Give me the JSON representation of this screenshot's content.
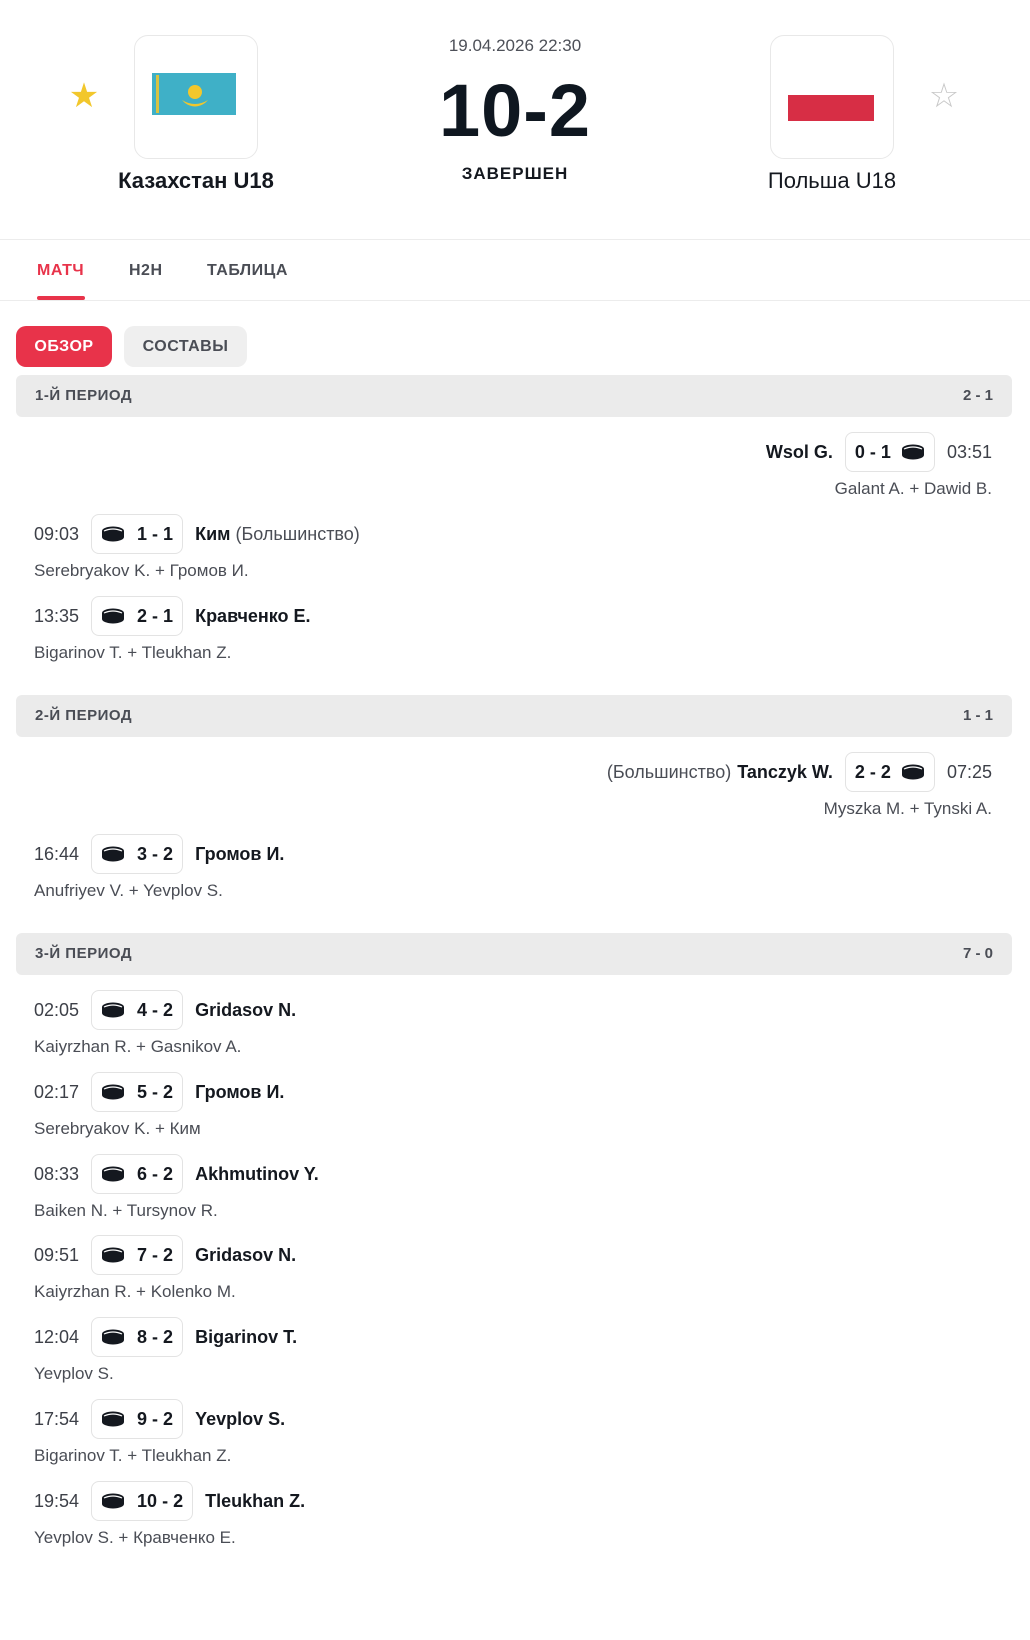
{
  "match": {
    "date": "19.04.2026 22:30",
    "score": "10-2",
    "status": "ЗАВЕРШЕН",
    "home": {
      "name": "Казахстан U18",
      "favorite": true,
      "star_color": "#f2c72c"
    },
    "away": {
      "name": "Польша U18",
      "favorite": false,
      "star_color": "#c8c8c8"
    }
  },
  "tabs": [
    {
      "label": "МАТЧ",
      "active": true
    },
    {
      "label": "H2H",
      "active": false
    },
    {
      "label": "ТАБЛИЦА",
      "active": false
    }
  ],
  "subtabs": [
    {
      "label": "ОБЗОР",
      "active": true
    },
    {
      "label": "СОСТАВЫ",
      "active": false
    }
  ],
  "periods": [
    {
      "title": "1-Й ПЕРИОД",
      "score": "2 - 1",
      "goals": [
        {
          "side": "away",
          "time": "03:51",
          "score": "0 - 1",
          "scorer": "Wsol G.",
          "note": "",
          "assists": "Galant A. + Dawid B."
        },
        {
          "side": "home",
          "time": "09:03",
          "score": "1 - 1",
          "scorer": "Ким",
          "note": "(Большинство)",
          "assists": "Serebryakov K. + Громов И."
        },
        {
          "side": "home",
          "time": "13:35",
          "score": "2 - 1",
          "scorer": "Кравченко Е.",
          "note": "",
          "assists": "Bigarinov T. + Tleukhan Z."
        }
      ]
    },
    {
      "title": "2-Й ПЕРИОД",
      "score": "1 - 1",
      "goals": [
        {
          "side": "away",
          "time": "07:25",
          "score": "2 - 2",
          "scorer": "Tanczyk W.",
          "note": "(Большинство)",
          "assists": "Myszka M. + Tynski A."
        },
        {
          "side": "home",
          "time": "16:44",
          "score": "3 - 2",
          "scorer": "Громов И.",
          "note": "",
          "assists": "Anufriyev V. + Yevplov S."
        }
      ]
    },
    {
      "title": "3-Й ПЕРИОД",
      "score": "7 - 0",
      "goals": [
        {
          "side": "home",
          "time": "02:05",
          "score": "4 - 2",
          "scorer": "Gridasov N.",
          "note": "",
          "assists": "Kaiyrzhan R. + Gasnikov A."
        },
        {
          "side": "home",
          "time": "02:17",
          "score": "5 - 2",
          "scorer": "Громов И.",
          "note": "",
          "assists": "Serebryakov K. + Ким"
        },
        {
          "side": "home",
          "time": "08:33",
          "score": "6 - 2",
          "scorer": "Akhmutinov Y.",
          "note": "",
          "assists": "Baiken N. + Tursynov R."
        },
        {
          "side": "home",
          "time": "09:51",
          "score": "7 - 2",
          "scorer": "Gridasov N.",
          "note": "",
          "assists": "Kaiyrzhan R. + Kolenko M."
        },
        {
          "side": "home",
          "time": "12:04",
          "score": "8 - 2",
          "scorer": "Bigarinov T.",
          "note": "",
          "assists": "Yevplov S."
        },
        {
          "side": "home",
          "time": "17:54",
          "score": "9 - 2",
          "scorer": "Yevplov S.",
          "note": "",
          "assists": "Bigarinov T. + Tleukhan Z."
        },
        {
          "side": "home",
          "time": "19:54",
          "score": "10 - 2",
          "scorer": "Tleukhan Z.",
          "note": "",
          "assists": "Yevplov S. + Кравченко Е."
        }
      ]
    }
  ],
  "colors": {
    "accent": "#e8334a",
    "kz_flag": "#3fb0c7",
    "kz_emblem": "#f2c72c",
    "pl_red": "#d72e45"
  },
  "icons": {
    "home_favorite": "star-filled-icon",
    "away_favorite": "star-outline-icon",
    "goal": "puck-icon"
  }
}
